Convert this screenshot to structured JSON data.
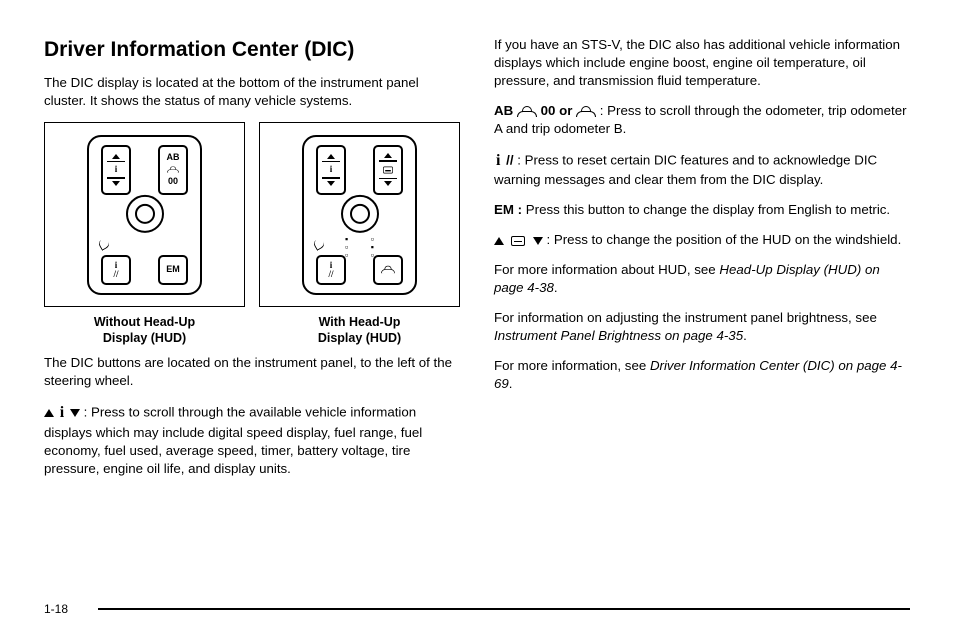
{
  "page_number": "1-18",
  "left": {
    "title": "Driver Information Center (DIC)",
    "intro": "The DIC display is located at the bottom of the instrument panel cluster. It shows the status of many vehicle systems.",
    "figures": {
      "without_hud_caption_l1": "Without Head-Up",
      "without_hud_caption_l2": "Display (HUD)",
      "with_hud_caption_l1": "With Head-Up",
      "with_hud_caption_l2": "Display (HUD)",
      "btn_ab": "AB",
      "btn_00": "00",
      "btn_em": "EM"
    },
    "location": "The DIC buttons are located on the instrument panel, to the left of the steering wheel.",
    "i_scroll_lead": " :  Press to scroll through the available vehicle information displays which may include digital speed display, fuel range, fuel economy, fuel used, average speed, timer, battery voltage, tire pressure, engine oil life, and display units."
  },
  "right": {
    "stsv": "If you have an STS-V, the DIC also has additional vehicle information displays which include engine boost, engine oil temperature, oil pressure, and transmission fluid temperature.",
    "ab_label": "AB ",
    "ab_mid": " 00 or ",
    "ab_tail": " :  Press to scroll through the odometer, trip odometer A and trip odometer B.",
    "reset_lead": " // ",
    "reset_tail": " :  Press to reset certain DIC features and to acknowledge DIC warning messages and clear them from the DIC display.",
    "em_label": "EM : ",
    "em_tail": " Press this button to change the display from English to metric.",
    "hud_tail": " :  Press to change the position of the HUD on the windshield.",
    "hud_ref_a": "For more information about HUD, see ",
    "hud_ref_b": "Head-Up Display (HUD) on page 4-38",
    "bright_a": "For information on adjusting the instrument panel brightness, see ",
    "bright_b": "Instrument Panel Brightness on page 4-35",
    "more_a": "For more information, see ",
    "more_b": "Driver Information Center (DIC) on page 4-69",
    "period": "."
  }
}
